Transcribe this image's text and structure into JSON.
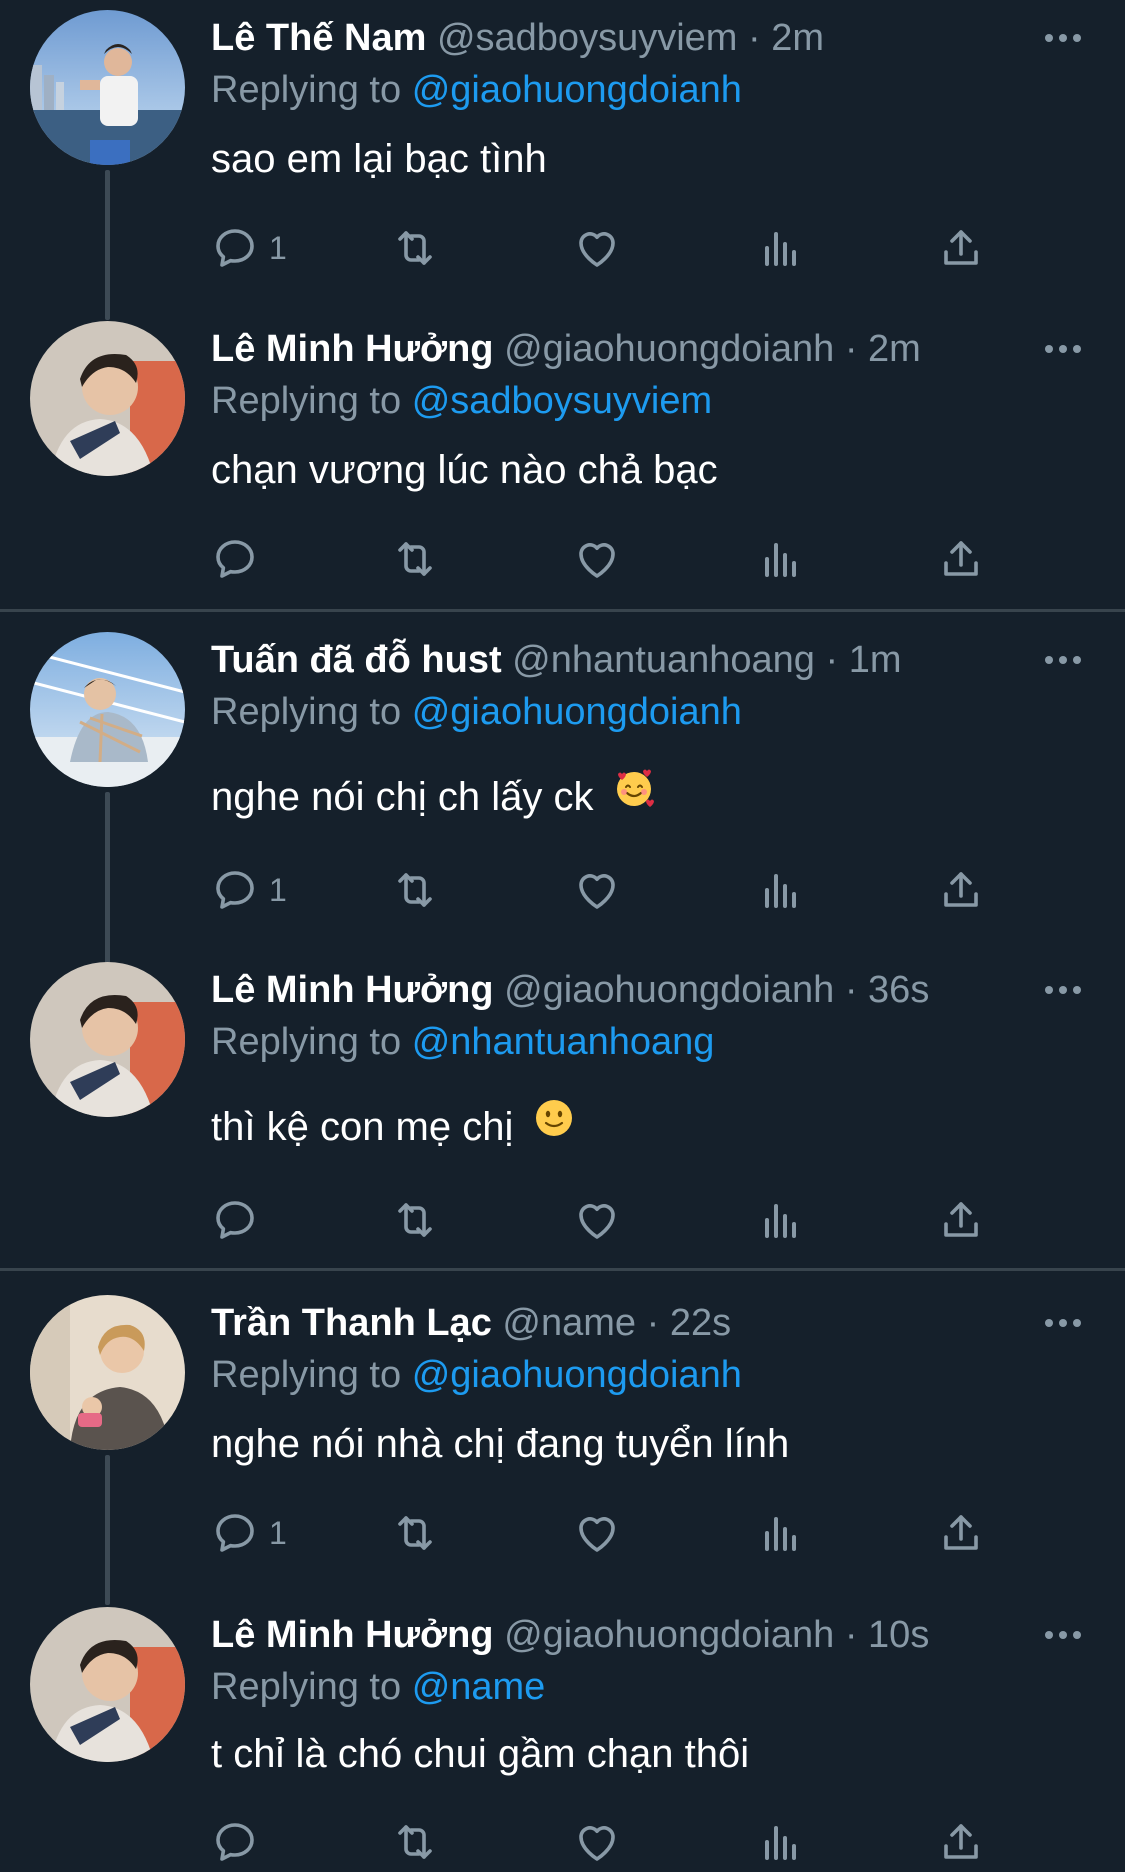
{
  "replying_prefix": "Replying to",
  "colors": {
    "background": "#15202b",
    "mention": "#1d9bf0",
    "muted": "#8899a6",
    "divider": "#38444d"
  },
  "icons": {
    "reply": "reply-icon",
    "retweet": "retweet-icon",
    "like": "heart-icon",
    "views": "views-icon",
    "share": "share-icon",
    "more": "more-icon"
  },
  "tweets": [
    {
      "name": "Lê Thế Nam",
      "handle": "@sadboysuyviem",
      "separator": "·",
      "time": "2m",
      "replying_to": "@giaohuongdoianh",
      "text": "sao em lại bạc tình",
      "reply_count": "1",
      "emoji": ""
    },
    {
      "name": "Lê Minh Hưởng",
      "handle": "@giaohuongdoianh",
      "separator": "·",
      "time": "2m",
      "replying_to": "@sadboysuyviem",
      "text": "chạn vương lúc nào chả bạc",
      "reply_count": "",
      "emoji": ""
    },
    {
      "name": "Tuấn đã đỗ hust",
      "handle": "@nhantuanhoang",
      "separator": "·",
      "time": "1m",
      "replying_to": "@giaohuongdoianh",
      "text": "nghe nói chị ch lấy ck",
      "reply_count": "1",
      "emoji": "smiling-face-with-hearts"
    },
    {
      "name": "Lê Minh Hưởng",
      "handle": "@giaohuongdoianh",
      "separator": "·",
      "time": "36s",
      "replying_to": "@nhantuanhoang",
      "text": "thì kệ con mẹ chị",
      "reply_count": "",
      "emoji": "slightly-smiling-face"
    },
    {
      "name": "Trần Thanh Lạc",
      "handle": "@name",
      "separator": "·",
      "time": "22s",
      "replying_to": "@giaohuongdoianh",
      "text": "nghe nói nhà chị đang tuyển lính",
      "reply_count": "1",
      "emoji": ""
    },
    {
      "name": "Lê Minh Hưởng",
      "handle": "@giaohuongdoianh",
      "separator": "·",
      "time": "10s",
      "replying_to": "@name",
      "text": "t chỉ là chó chui gầm chạn thôi",
      "reply_count": "",
      "emoji": ""
    }
  ]
}
